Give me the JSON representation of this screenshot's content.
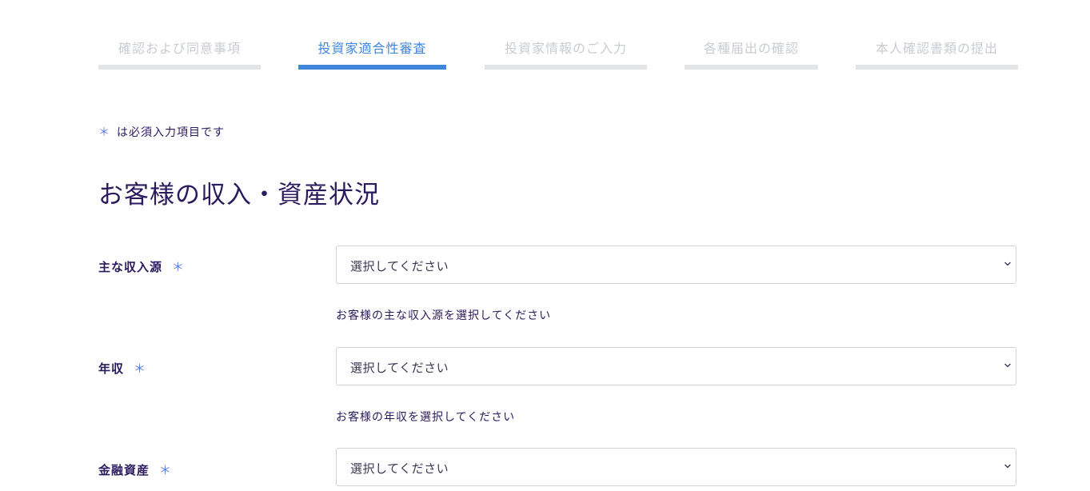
{
  "steps": [
    {
      "label": "確認および同意事項",
      "active": false
    },
    {
      "label": "投資家適合性審査",
      "active": true
    },
    {
      "label": "投資家情報のご入力",
      "active": false
    },
    {
      "label": "各種届出の確認",
      "active": false
    },
    {
      "label": "本人確認書類の提出",
      "active": false
    }
  ],
  "required_note": {
    "asterisk": "＊",
    "text": "は必須入力項目です"
  },
  "section_title": "お客様の収入・資産状況",
  "fields": [
    {
      "label": "主な収入源",
      "required_mark": "＊",
      "selected": "選択してください",
      "help": "お客様の主な収入源を選択してください"
    },
    {
      "label": "年収",
      "required_mark": "＊",
      "selected": "選択してください",
      "help": "お客様の年収を選択してください"
    },
    {
      "label": "金融資産",
      "required_mark": "＊",
      "selected": "選択してください"
    }
  ],
  "icons": {
    "select_chevron": "chevron-down-icon"
  },
  "colors": {
    "accent": "#3f86dc",
    "inactive_step": "#c9ccd3",
    "text": "#2a1a5e",
    "required_mark": "#5b7fe0"
  }
}
